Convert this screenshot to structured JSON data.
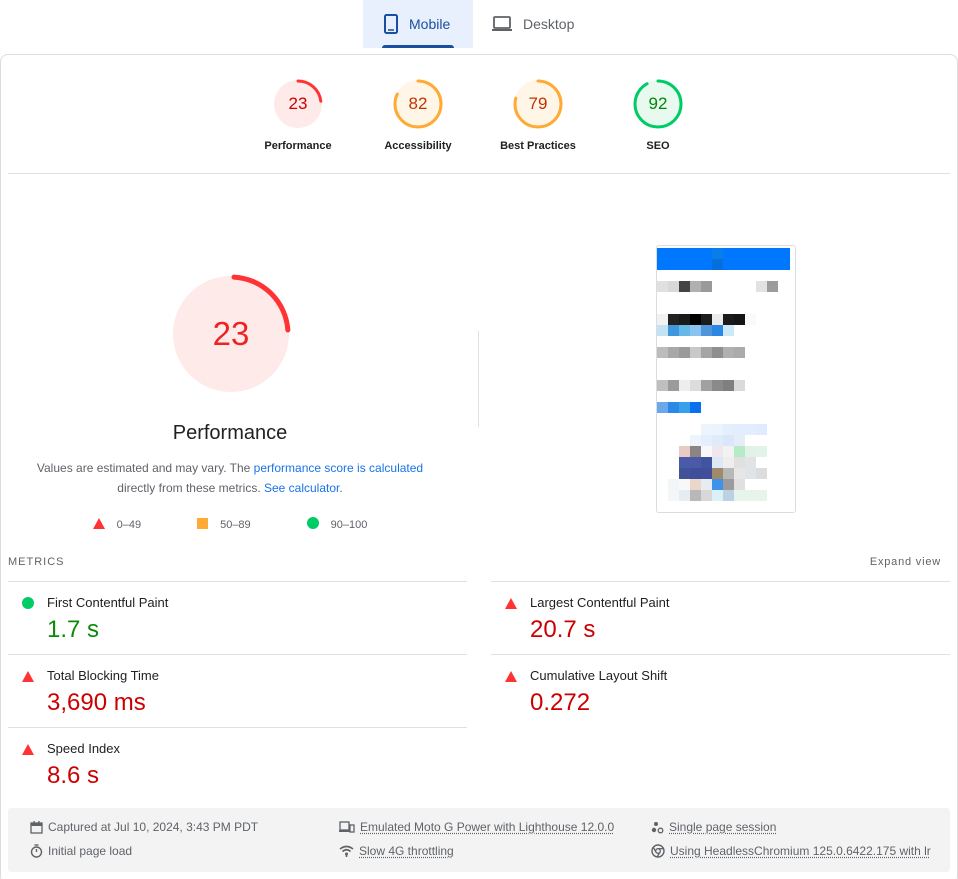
{
  "tabs": [
    {
      "label": "Mobile",
      "icon": "smartphone-icon",
      "active": true
    },
    {
      "label": "Desktop",
      "icon": "laptop-icon",
      "active": false
    }
  ],
  "scores": [
    {
      "label": "Performance",
      "value": 23,
      "status": "poor",
      "color": "#ff3333",
      "bg": "#ffeaea",
      "text_color": "#cc0000"
    },
    {
      "label": "Accessibility",
      "value": 82,
      "status": "average",
      "color": "#ffaa33",
      "bg": "#fff6e8",
      "text_color": "#c33300"
    },
    {
      "label": "Best Practices",
      "value": 79,
      "status": "average",
      "color": "#ffaa33",
      "bg": "#fff6e8",
      "text_color": "#c33300"
    },
    {
      "label": "SEO",
      "value": 92,
      "status": "good",
      "color": "#00cc66",
      "bg": "#e8faef",
      "text_color": "#008800"
    }
  ],
  "gauge": {
    "value": 23,
    "title": "Performance",
    "note_prefix": "Values are estimated and may vary. The ",
    "note_link1": "performance score is calculated",
    "note_mid": " directly from these metrics. ",
    "note_link2": "See calculator."
  },
  "legend": [
    {
      "range": "0–49",
      "shape": "triangle",
      "color": "#ff3333"
    },
    {
      "range": "50–89",
      "shape": "square",
      "color": "#ffaa33"
    },
    {
      "range": "90–100",
      "shape": "circle",
      "color": "#00cc66"
    }
  ],
  "metrics": {
    "header": "METRICS",
    "expand_label": "Expand view",
    "items": [
      {
        "name": "First Contentful Paint",
        "value": "1.7 s",
        "status": "good"
      },
      {
        "name": "Largest Contentful Paint",
        "value": "20.7 s",
        "status": "poor"
      },
      {
        "name": "Total Blocking Time",
        "value": "3,690 ms",
        "status": "poor"
      },
      {
        "name": "Cumulative Layout Shift",
        "value": "0.272",
        "status": "poor"
      },
      {
        "name": "Speed Index",
        "value": "8.6 s",
        "status": "poor"
      }
    ]
  },
  "footer": {
    "captured": "Captured at Jul 10, 2024, 3:43 PM PDT",
    "page_load": "Initial page load",
    "device": "Emulated Moto G Power with Lighthouse 12.0.0",
    "throttling": "Slow 4G throttling",
    "session": "Single page session",
    "browser": "Using HeadlessChromium 125.0.6422.175 with lr"
  }
}
